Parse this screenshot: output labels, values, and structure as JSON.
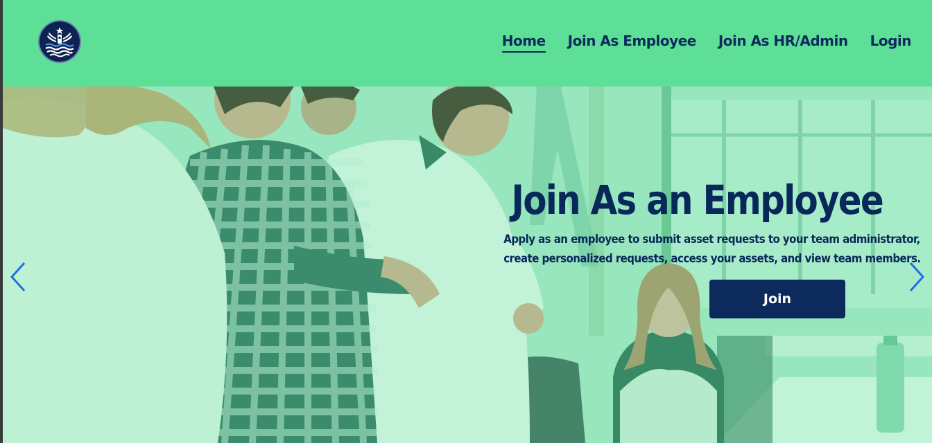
{
  "nav": {
    "items": [
      {
        "label": "Home",
        "active": true
      },
      {
        "label": "Join As Employee",
        "active": false
      },
      {
        "label": "Join As HR/Admin",
        "active": false
      },
      {
        "label": "Login",
        "active": false
      }
    ]
  },
  "hero": {
    "title": "Join As an Employee",
    "description_line1": "Apply as an employee to submit asset requests to your team administrator,",
    "description_line2": "create personalized requests, access your assets, and view team members.",
    "button_label": "Join"
  },
  "icons": {
    "logo": "lighthouse-waves-logo",
    "prev": "chevron-left-icon",
    "next": "chevron-right-icon"
  },
  "colors": {
    "navbar": "#5ddf97",
    "primary": "#0c2a5c",
    "arrow": "#1f6fe0"
  }
}
